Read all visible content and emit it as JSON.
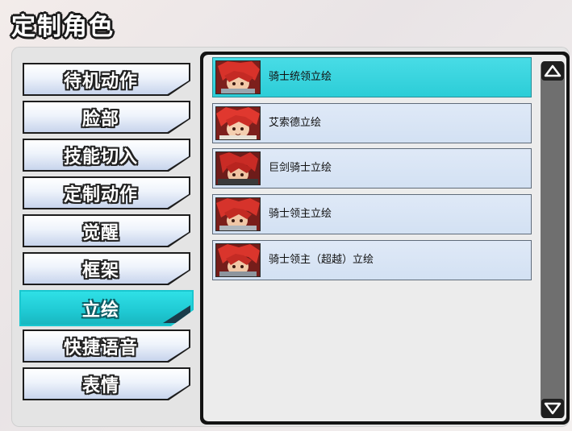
{
  "header": {
    "title": "定制角色"
  },
  "categories": [
    {
      "label": "待机动作",
      "active": false
    },
    {
      "label": "脸部",
      "active": false
    },
    {
      "label": "技能切入",
      "active": false
    },
    {
      "label": "定制动作",
      "active": false
    },
    {
      "label": "觉醒",
      "active": false
    },
    {
      "label": "框架",
      "active": false
    },
    {
      "label": "立绘",
      "active": true
    },
    {
      "label": "快捷语音",
      "active": false
    },
    {
      "label": "表情",
      "active": false
    }
  ],
  "items": [
    {
      "label": "骑士统领立绘",
      "selected": true,
      "icon": "red-hair-knight-portrait"
    },
    {
      "label": "艾索德立绘",
      "selected": false,
      "icon": "red-hair-knight-portrait"
    },
    {
      "label": "巨剑骑士立绘",
      "selected": false,
      "icon": "red-hair-knight-portrait"
    },
    {
      "label": "骑士领主立绘",
      "selected": false,
      "icon": "red-hair-knight-portrait"
    },
    {
      "label": "骑士领主（超越）立绘",
      "selected": false,
      "icon": "red-hair-knight-portrait"
    }
  ],
  "scrollbar": {
    "up_icon": "triangle-up-icon",
    "down_icon": "triangle-down-icon"
  },
  "colors": {
    "accent": "#1fc9d3",
    "panel": "#e4e4e4",
    "item": "#d9e5f5"
  }
}
